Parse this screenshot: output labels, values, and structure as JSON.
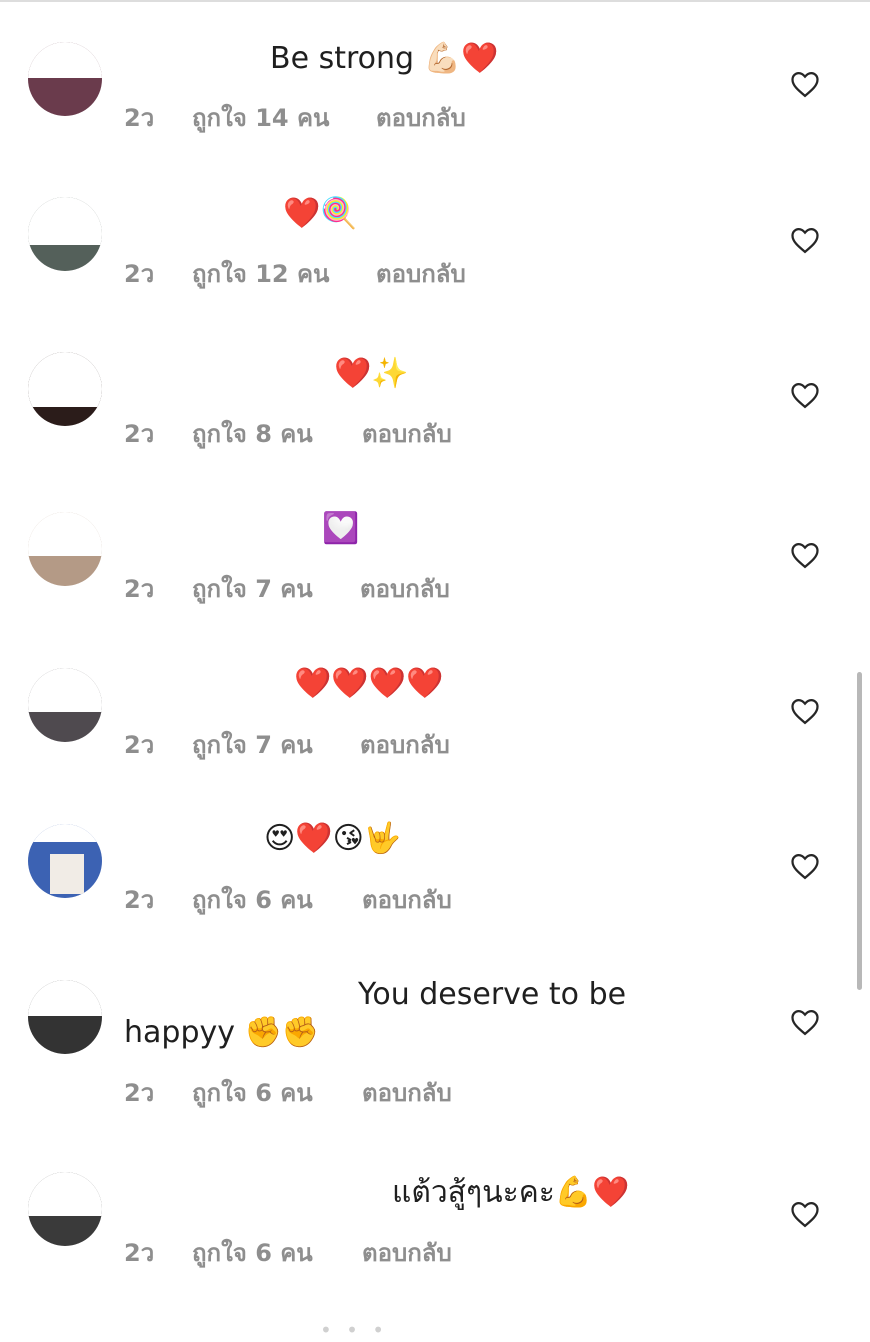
{
  "comments": [
    {
      "text": "Be strong 💪🏻❤️",
      "time": "2ว",
      "likes": "ถูกใจ 14 คน",
      "reply": "ตอบกลับ"
    },
    {
      "text": "❤️🍭",
      "time": "2ว",
      "likes": "ถูกใจ 12 คน",
      "reply": "ตอบกลับ"
    },
    {
      "text": "❤️✨",
      "time": "2ว",
      "likes": "ถูกใจ 8 คน",
      "reply": "ตอบกลับ"
    },
    {
      "text": "💟",
      "time": "2ว",
      "likes": "ถูกใจ 7 คน",
      "reply": "ตอบกลับ"
    },
    {
      "text": "❤️❤️❤️❤️",
      "time": "2ว",
      "likes": "ถูกใจ 7 คน",
      "reply": "ตอบกลับ"
    },
    {
      "text": "😍❤️😘🤟",
      "time": "2ว",
      "likes": "ถูกใจ 6 คน",
      "reply": "ตอบกลับ"
    },
    {
      "text": "You deserve to be",
      "text_line2": "happyy ✊✊",
      "time": "2ว",
      "likes": "ถูกใจ 6 คน",
      "reply": "ตอบกลับ"
    },
    {
      "text": "แต้วสู้ๆนะคะ💪❤️",
      "time": "2ว",
      "likes": "ถูกใจ 6 คน",
      "reply": "ตอบกลับ"
    }
  ],
  "icons": {
    "like": "heart-outline-icon"
  },
  "colors": {
    "meta": "#8e8e8e",
    "text": "#1f1f1f",
    "background": "#ffffff"
  },
  "footer_partial": "• • •"
}
